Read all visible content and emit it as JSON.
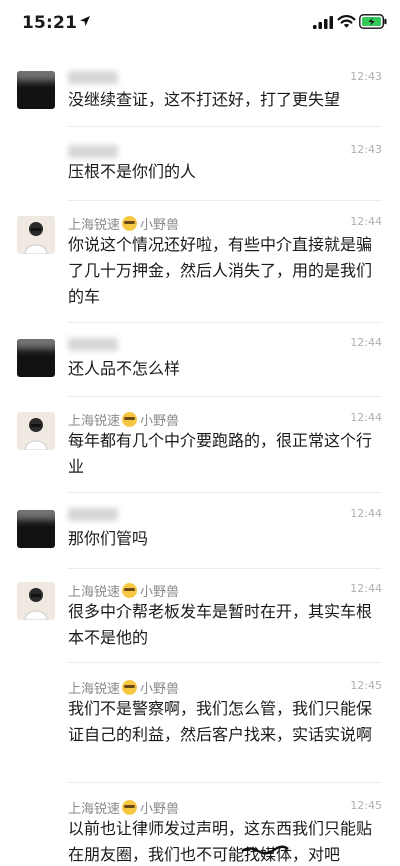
{
  "status_bar": {
    "time": "15:21"
  },
  "colors": {
    "meta_gray": "#8a8a8a",
    "time_gray": "#b0b0b0",
    "divider": "#ececec"
  },
  "messages": [
    {
      "sender": "",
      "time": "12:43",
      "text": "没继续查证，这不打还好，打了更失望"
    },
    {
      "sender": "",
      "time": "12:43",
      "text": "压根不是你们的人"
    },
    {
      "sender_prefix": "上海锐速",
      "sender_suffix": "小野兽",
      "time": "12:44",
      "text": "你说这个情况还好啦，有些中介直接就是骗了几十万押金，然后人消失了，用的是我们的车"
    },
    {
      "sender": "",
      "time": "12:44",
      "text": "还人品不怎么样"
    },
    {
      "sender_prefix": "上海锐速",
      "sender_suffix": "小野兽",
      "time": "12:44",
      "text": "每年都有几个中介要跑路的，很正常这个行业"
    },
    {
      "sender": "",
      "time": "12:44",
      "text": "那你们管吗"
    },
    {
      "sender_prefix": "上海锐速",
      "sender_suffix": "小野兽",
      "time": "12:44",
      "text": "很多中介帮老板发车是暂时在开，其实车根本不是他的"
    },
    {
      "sender_prefix": "上海锐速",
      "sender_suffix": "小野兽",
      "time": "12:45",
      "text": "我们不是警察啊，我们怎么管，我们只能保证自己的利益，然后客户找来，实话实说啊"
    },
    {
      "sender_prefix": "上海锐速",
      "sender_suffix": "小野兽",
      "time": "12:45",
      "text": "以前也让律师发过声明，这东西我们只能贴在朋友圈，我们也不可能找媒体，对吧"
    }
  ]
}
